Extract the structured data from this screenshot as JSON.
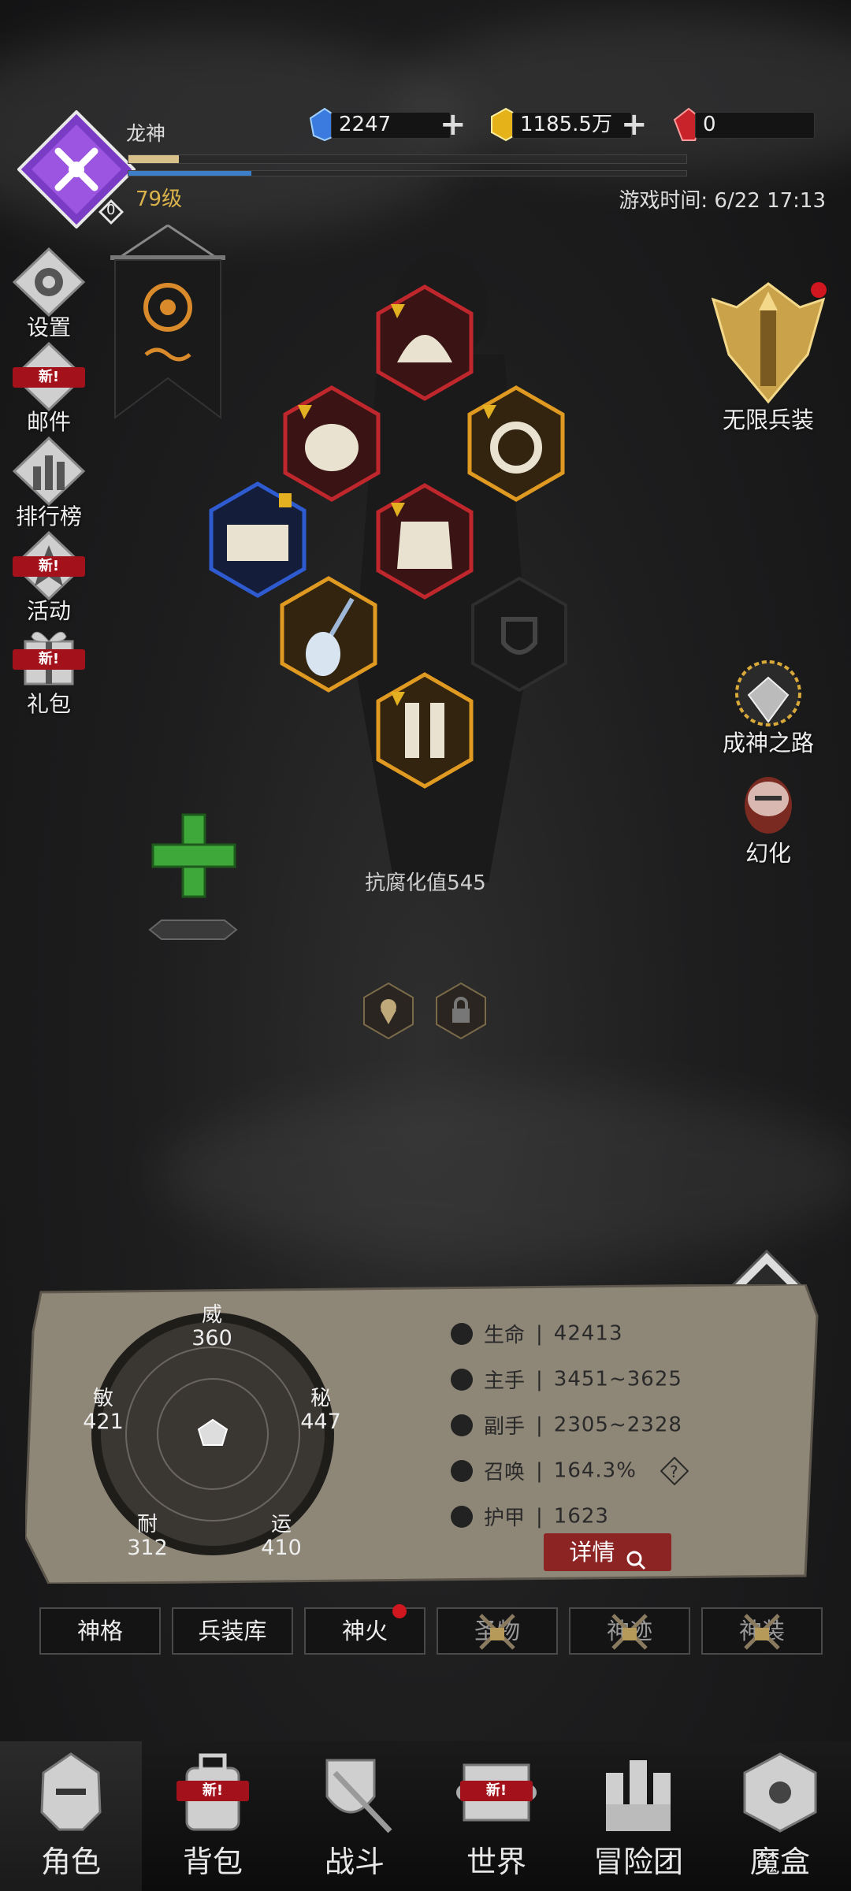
{
  "player": {
    "name": "龙神",
    "level": "79级",
    "avatar_rank": "0",
    "exp_fill": 0.09,
    "mp_fill": 0.22
  },
  "currencies": [
    {
      "name": "blue-gem",
      "value": "2247",
      "color": "#3b7be0"
    },
    {
      "name": "gold-gem",
      "value": "1185.5万",
      "color": "#e5b21a"
    },
    {
      "name": "red-gem",
      "value": "0",
      "color": "#c8232a"
    }
  ],
  "game_time": "游戏时间: 6/22 17:13",
  "left_menu": [
    {
      "label": "设置",
      "icon": "gear-icon",
      "badge": ""
    },
    {
      "label": "邮件",
      "icon": "mail-icon",
      "badge": "新!"
    },
    {
      "label": "排行榜",
      "icon": "ranking-icon",
      "badge": ""
    },
    {
      "label": "活动",
      "icon": "event-icon",
      "badge": "新!"
    },
    {
      "label": "礼包",
      "icon": "gift-icon",
      "badge": "新!"
    }
  ],
  "right_menu": [
    {
      "label": "无限兵装",
      "icon": "infinite-arms-icon"
    },
    {
      "label": "成神之路",
      "icon": "godhood-path-icon"
    },
    {
      "label": "幻化",
      "icon": "transform-icon"
    }
  ],
  "corruption_resist": "抗腐化值545",
  "attributes": [
    {
      "key": "威",
      "value": "360"
    },
    {
      "key": "秘",
      "value": "447"
    },
    {
      "key": "运",
      "value": "410"
    },
    {
      "key": "耐",
      "value": "312"
    },
    {
      "key": "敏",
      "value": "421"
    }
  ],
  "stats": [
    {
      "key": "生命",
      "value": "42413",
      "icon": "heart-icon"
    },
    {
      "key": "主手",
      "value": "3451~3625",
      "icon": "main-hand-icon"
    },
    {
      "key": "副手",
      "value": "2305~2328",
      "icon": "off-hand-icon"
    },
    {
      "key": "召唤",
      "value": "164.3%",
      "icon": "summon-icon"
    },
    {
      "key": "护甲",
      "value": "1623",
      "icon": "armor-icon"
    }
  ],
  "detail_label": "详情",
  "tabs": [
    {
      "label": "神格",
      "locked": false
    },
    {
      "label": "兵装库",
      "locked": false
    },
    {
      "label": "神火",
      "locked": false
    },
    {
      "label": "圣物",
      "locked": true
    },
    {
      "label": "神迹",
      "locked": true
    },
    {
      "label": "神装",
      "locked": true
    }
  ],
  "bottom_nav": [
    {
      "label": "角色",
      "icon": "helmet-icon",
      "badge": ""
    },
    {
      "label": "背包",
      "icon": "backpack-icon",
      "badge": "新!"
    },
    {
      "label": "战斗",
      "icon": "shield-sword-icon",
      "badge": ""
    },
    {
      "label": "世界",
      "icon": "scroll-icon",
      "badge": "新!"
    },
    {
      "label": "冒险团",
      "icon": "castle-icon",
      "badge": ""
    },
    {
      "label": "魔盒",
      "icon": "magic-box-icon",
      "badge": ""
    }
  ]
}
